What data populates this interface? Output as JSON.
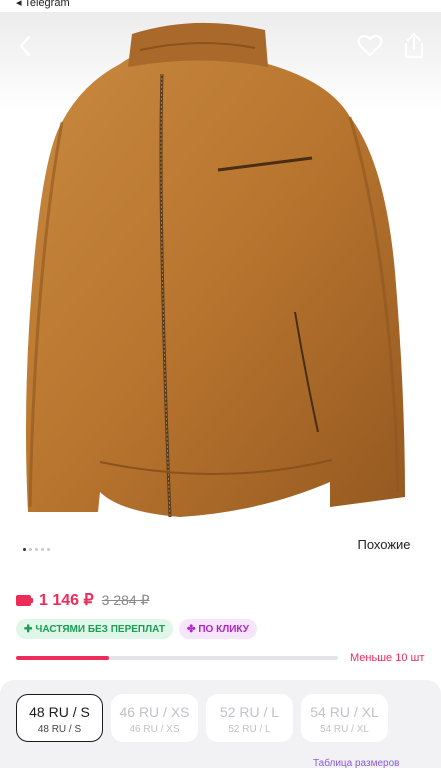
{
  "status": {
    "app": "◂ Telegram"
  },
  "hero": {
    "image_alt": "Brown leather jacket",
    "similar_label": "Похожие",
    "dots": {
      "count": 5,
      "active": 0
    }
  },
  "price": {
    "current": "1 146 ₽",
    "old": "3 284 ₽"
  },
  "badges": {
    "installments": "ЧАСТЯМИ БЕЗ ПЕРЕПЛАТ",
    "one_click": "ПО КЛИКУ"
  },
  "stock": {
    "label": "Меньше 10 шт",
    "progress": 0.29
  },
  "sizes": [
    {
      "main": "48 RU / S",
      "sub": "48 RU / S",
      "selected": true
    },
    {
      "main": "46 RU / XS",
      "sub": "46 RU / XS",
      "selected": false
    },
    {
      "main": "52 RU / L",
      "sub": "52 RU / L",
      "selected": false
    },
    {
      "main": "54 RU / XL",
      "sub": "54 RU / XL",
      "selected": false
    }
  ],
  "size_table": "Таблица размеров",
  "colors": {
    "accent": "#ee2c5b",
    "jacket": "#b8752f",
    "installments": "#1c9d55",
    "one_click": "#b322c9"
  },
  "icons": [
    "back-icon",
    "heart-icon",
    "share-icon",
    "wallet-icon",
    "plus-icon",
    "fan-icon"
  ]
}
